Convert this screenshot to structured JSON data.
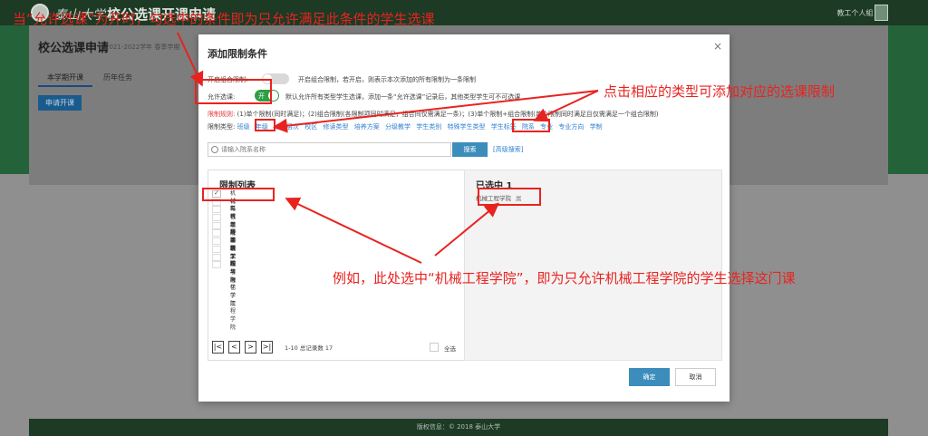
{
  "header": {
    "logo_script": "泰山大学",
    "title": "校公选课开课申请",
    "user_menu": "教工个人組 ▾"
  },
  "page": {
    "title": "校公选课申请",
    "subtitle": "2021-2022学年 春季学期",
    "tabs": [
      "本学期开课",
      "历年任务"
    ],
    "apply_button": "申请开课"
  },
  "footer": "版权信息：© 2018 泰山大学",
  "modal": {
    "title": "添加限制条件",
    "close": "×",
    "combo_label": "开启组合限制:",
    "combo_desc": "开启组合限制，若开启，则表示本次添加的所有限制为一条限制",
    "allow_label": "允许选课:",
    "allow_toggle": "开",
    "allow_desc": "默认允许所有类型学生选课，添加一条“允许选课”记录后，其他类型学生可不可选课",
    "rule_label": "限制规则:",
    "rule_text": "(1)单个限制(同时满足)；(2)组合限制(各限制项同时满足，组合间仅需满足一条)；(3)单个限制+组合限制(单个限制同时满足且仅需满足一个组合限制)",
    "type_label": "限制类型:",
    "types": [
      "班级",
      "年级",
      "培养层次",
      "校区",
      "修读类型",
      "培养方案",
      "分级教学",
      "学生类别",
      "特殊学生类型",
      "学生标签",
      "院系",
      "专业",
      "专业方向",
      "学制"
    ],
    "search_placeholder": "请输入院系名称",
    "search_button": "搜索",
    "advanced_search": "[高级搜索]",
    "list_title": "限制列表",
    "list_items": [
      {
        "label": "机械工程学院",
        "checked": true
      },
      {
        "label": "材料科学与工程学院",
        "checked": false
      },
      {
        "label": "电气工程学院",
        "checked": false
      },
      {
        "label": "信息科学与工程学院",
        "checked": false
      },
      {
        "label": "经济管理学院",
        "checked": false
      },
      {
        "label": "外国语学院",
        "checked": false
      },
      {
        "label": "建筑工程与力学学院",
        "checked": false
      },
      {
        "label": "理学院",
        "checked": false
      },
      {
        "label": "文法学院",
        "checked": false
      },
      {
        "label": "环境与化学工程学院",
        "checked": false
      }
    ],
    "pager": {
      "first": "|<",
      "prev": "<",
      "next": ">",
      "last": ">|",
      "info": "1-10 总记录数 17"
    },
    "select_all": "全选",
    "selected_title": "已选中 1",
    "selected_items": [
      {
        "label": "机械工程学院",
        "remove": "属"
      }
    ],
    "ok_button": "确定",
    "cancel_button": "取消"
  },
  "annotations": {
    "top": "当“允许选课”为开时，勾选中的条件即为只允许满足此条件的学生选课",
    "right": "点击相应的类型可添加对应的选课限制",
    "bottom": "例如，此处选中“机械工程学院”，即为只允许机械工程学院的学生选择这门课"
  },
  "colors": {
    "annotation": "#e8231f",
    "link": "#2f80d1",
    "primary": "#3c8dbc",
    "toggle_on": "#2f9e44",
    "header": "#1c3a24",
    "band": "#24623a"
  }
}
